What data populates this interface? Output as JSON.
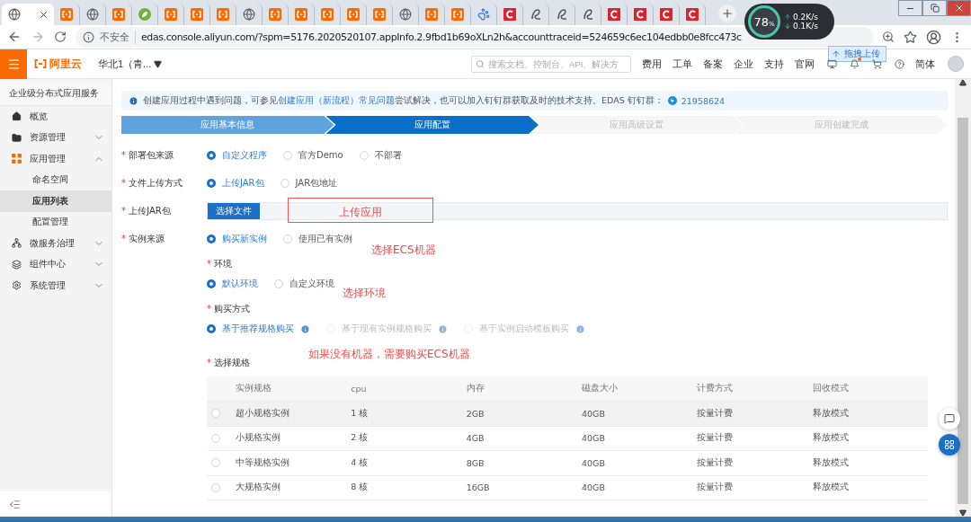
{
  "browser": {
    "tabs": [
      {
        "kind": "globe",
        "selected": true
      },
      {
        "kind": "aliyun",
        "selected": false
      },
      {
        "kind": "globe",
        "selected": false
      },
      {
        "kind": "aliyun",
        "selected": false
      },
      {
        "kind": "leaf",
        "selected": false
      },
      {
        "kind": "aliyun",
        "selected": false
      },
      {
        "kind": "aliyun",
        "selected": false
      },
      {
        "kind": "aliyun",
        "selected": false
      },
      {
        "kind": "globe",
        "selected": false
      },
      {
        "kind": "aliyun",
        "selected": false
      },
      {
        "kind": "aliyun",
        "selected": false
      },
      {
        "kind": "aliyun",
        "selected": false
      },
      {
        "kind": "aliyun",
        "selected": false
      },
      {
        "kind": "aliyun",
        "selected": false
      },
      {
        "kind": "globe",
        "selected": false
      },
      {
        "kind": "aliyun",
        "selected": false
      },
      {
        "kind": "aliyun",
        "selected": false
      },
      {
        "kind": "paw",
        "selected": false
      },
      {
        "kind": "crescent",
        "selected": false
      },
      {
        "kind": "swirl",
        "selected": false
      },
      {
        "kind": "swirl",
        "selected": false
      },
      {
        "kind": "swirl",
        "selected": false
      },
      {
        "kind": "crescent",
        "selected": false
      },
      {
        "kind": "crescent",
        "selected": false
      },
      {
        "kind": "crescent",
        "selected": false
      },
      {
        "kind": "crescent",
        "selected": false
      }
    ],
    "security": "不安全",
    "url": "edas.console.aliyun.com/?spm=5176.2020520107.appInfo.2.9fbd1b69oXLn2h&accounttraceid=524659c6ec104edbb0e8fcc473c",
    "speed_widget": {
      "percent": "78",
      "unit": "%",
      "up": "0.2K/s",
      "down": "0.1K/s"
    },
    "upload_button": "拖拽上传"
  },
  "header": {
    "logo": "阿里云",
    "region": "华北1（青...",
    "search_placeholder": "搜索文档、控制台、API、解决方",
    "nav": [
      "费用",
      "工单",
      "备案",
      "企业",
      "支持",
      "官网"
    ],
    "language": "简体"
  },
  "sidebar": {
    "title": "企业级分布式应用服务",
    "items": [
      {
        "kind": "home",
        "label": "概览"
      },
      {
        "kind": "folder",
        "label": "资源管理",
        "expanded": false
      },
      {
        "kind": "apps",
        "label": "应用管理",
        "expanded": true,
        "children": [
          {
            "label": "命名空间",
            "selected": false
          },
          {
            "label": "应用列表",
            "selected": true
          },
          {
            "label": "配置管理",
            "selected": false
          }
        ]
      },
      {
        "kind": "network",
        "label": "微服务治理",
        "expanded": false
      },
      {
        "kind": "layers",
        "label": "组件中心",
        "expanded": false
      },
      {
        "kind": "gear",
        "label": "系统管理",
        "expanded": false
      }
    ]
  },
  "notice": {
    "before": "创建应用过程中遇到问题，可参见",
    "link": "创建应用（新流程）常见问题",
    "after": "尝试解决，也可以加入钉钉群获取及时的技术支持。EDAS 钉钉群：",
    "group": "21958624"
  },
  "steps": [
    {
      "label": "应用基本信息",
      "kind": "done"
    },
    {
      "label": "应用配置",
      "kind": "active"
    },
    {
      "label": "应用高级设置",
      "kind": "pending"
    },
    {
      "label": "应用创建完成",
      "kind": "pending"
    }
  ],
  "form": [
    {
      "kind": "radio",
      "mark": "*",
      "label": "部署包来源",
      "options": [
        {
          "label": "自定义程序",
          "selected": true
        },
        {
          "label": "官方Demo",
          "selected": false
        },
        {
          "label": "不部署",
          "selected": false
        }
      ]
    },
    {
      "kind": "radio",
      "mark": "*",
      "label": "文件上传方式",
      "options": [
        {
          "label": "上传JAR包",
          "selected": true
        },
        {
          "label": "JAR包地址",
          "selected": false
        }
      ]
    },
    {
      "kind": "file",
      "mark": "*",
      "label": "上传JAR包",
      "button": "选择文件"
    },
    {
      "kind": "radio",
      "mark": "*",
      "label": "实例来源",
      "options": [
        {
          "label": "购买新实例",
          "selected": true
        },
        {
          "label": "使用已有实例",
          "selected": false
        }
      ]
    }
  ],
  "environment": {
    "mark": "*",
    "label": "环境",
    "options": [
      {
        "label": "默认环境",
        "selected": true
      },
      {
        "label": "自定义环境",
        "selected": false
      }
    ]
  },
  "purchase": {
    "mark": "*",
    "label": "购买方式",
    "options": [
      {
        "label": "基于推荐规格购买",
        "selected": true,
        "disabled": false
      },
      {
        "label": "基于现有实例规格购买",
        "selected": false,
        "disabled": true
      },
      {
        "label": "基于实例启动模板购买",
        "selected": false,
        "disabled": true
      }
    ]
  },
  "spec": {
    "mark": "*",
    "label": "选择规格",
    "columns": [
      "实例规格",
      "cpu",
      "内存",
      "磁盘大小",
      "计费方式",
      "回收模式"
    ],
    "rows": [
      {
        "selected": false,
        "highlighted": true,
        "cells": [
          "超小规格实例",
          "1 核",
          "2GB",
          "40GB",
          "按量计费",
          "释放模式"
        ]
      },
      {
        "selected": false,
        "highlighted": false,
        "cells": [
          "小规格实例",
          "2 核",
          "4GB",
          "40GB",
          "按量计费",
          "释放模式"
        ]
      },
      {
        "selected": false,
        "highlighted": false,
        "cells": [
          "中等规格实例",
          "4 核",
          "8GB",
          "40GB",
          "按量计费",
          "释放模式"
        ]
      },
      {
        "selected": false,
        "highlighted": false,
        "cells": [
          "大规格实例",
          "8 核",
          "16GB",
          "40GB",
          "按量计费",
          "释放模式"
        ]
      }
    ]
  },
  "annotations": [
    {
      "text": "上传应用",
      "boxed": true
    },
    {
      "text": "选择ECS机器",
      "boxed": false
    },
    {
      "text": "选择环境",
      "boxed": false
    },
    {
      "text": "如果没有机器，需要购买ECS机器",
      "boxed": false
    }
  ]
}
